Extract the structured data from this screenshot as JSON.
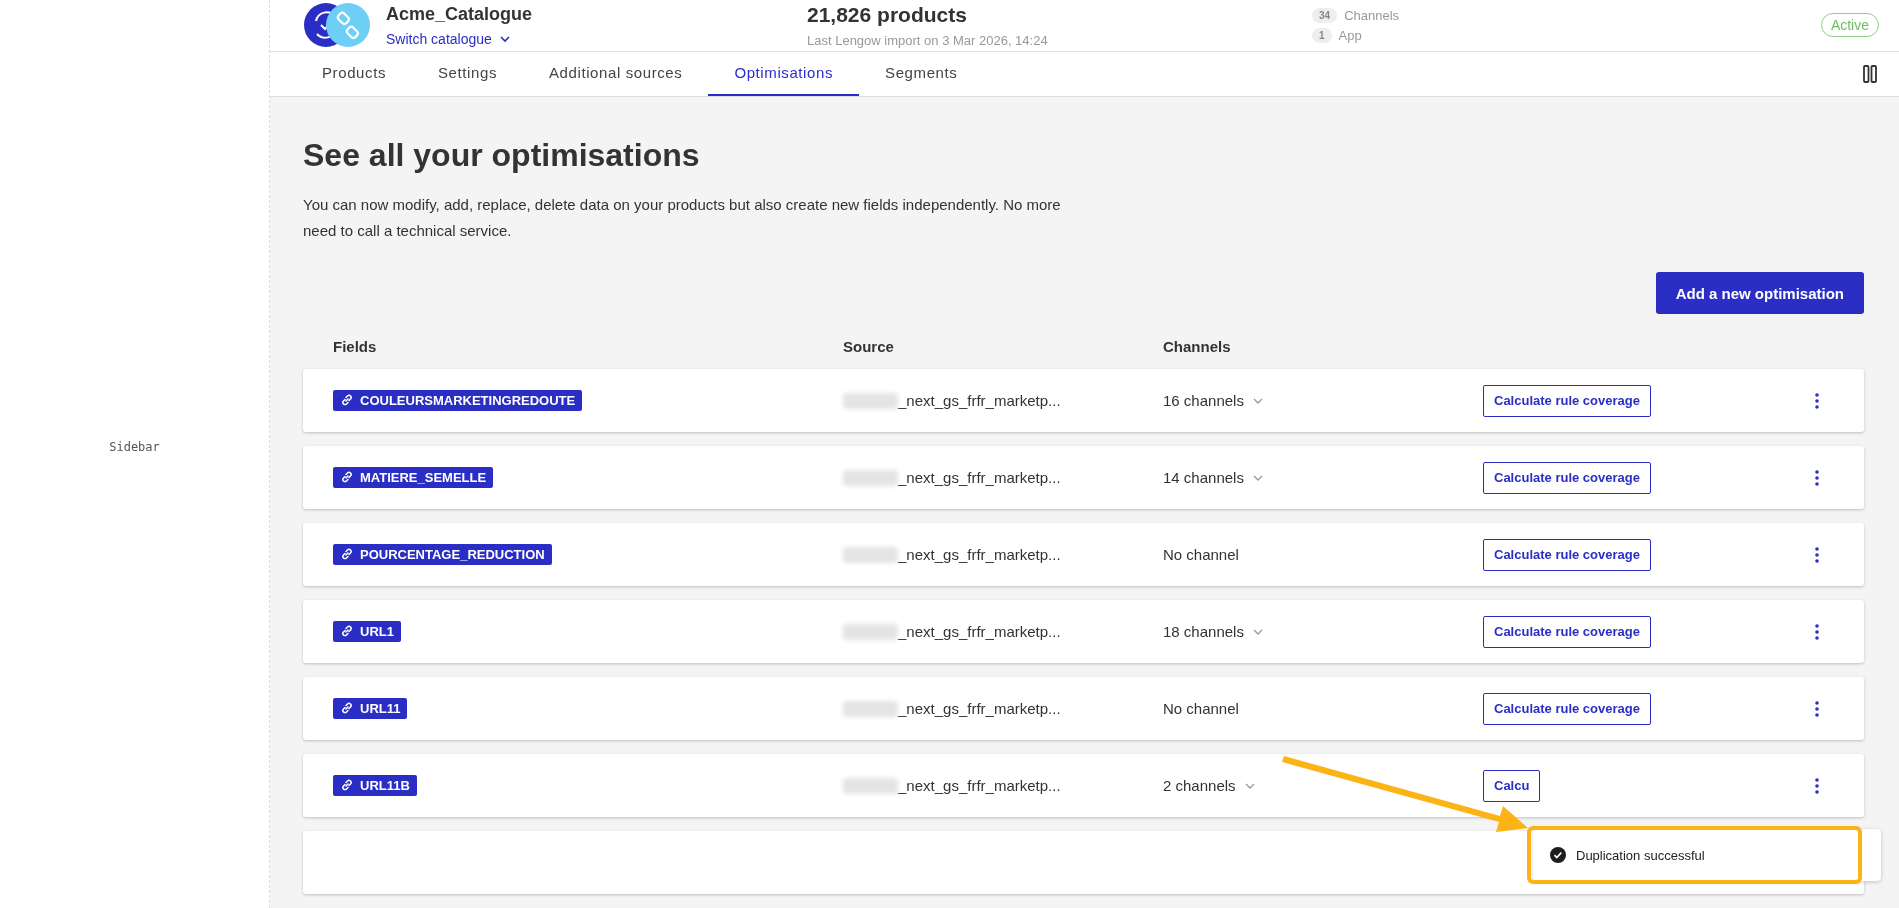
{
  "sidebar": {
    "label": "Sidebar"
  },
  "header": {
    "catalogue": "Acme_Catalogue",
    "switch_link": "Switch catalogue",
    "products": "21,826 products",
    "last_import": "Last Lengow import on 3 Mar 2026, 14:24",
    "counters": [
      {
        "count": "34",
        "label": "Channels"
      },
      {
        "count": "1",
        "label": "App"
      }
    ],
    "status": "Active"
  },
  "tabs": [
    {
      "label": "Products",
      "selected": false
    },
    {
      "label": "Settings",
      "selected": false
    },
    {
      "label": "Additional sources",
      "selected": false
    },
    {
      "label": "Optimisations",
      "selected": true
    },
    {
      "label": "Segments",
      "selected": false
    }
  ],
  "page": {
    "title": "See all your optimisations",
    "description": "You can now modify, add, replace, delete data on your products but also create new fields independently. No more need to call a technical service.",
    "add_button": "Add a new optimisation"
  },
  "table": {
    "columns": [
      "Fields",
      "Source",
      "Channels"
    ],
    "rows": [
      {
        "field": "COULEURSMARKETINGREDOUTE",
        "source": "_next_gs_frfr_marketp...",
        "channels": "16 channels",
        "expandable": true,
        "action": "Calculate rule coverage"
      },
      {
        "field": "MATIERE_SEMELLE",
        "source": "_next_gs_frfr_marketp...",
        "channels": "14 channels",
        "expandable": true,
        "action": "Calculate rule coverage"
      },
      {
        "field": "POURCENTAGE_REDUCTION",
        "source": "_next_gs_frfr_marketp...",
        "channels": "No channel",
        "expandable": false,
        "action": "Calculate rule coverage"
      },
      {
        "field": "URL1",
        "source": "_next_gs_frfr_marketp...",
        "channels": "18 channels",
        "expandable": true,
        "action": "Calculate rule coverage"
      },
      {
        "field": "URL11",
        "source": "_next_gs_frfr_marketp...",
        "channels": "No channel",
        "expandable": false,
        "action": "Calculate rule coverage"
      },
      {
        "field": "URL11B",
        "source": "_next_gs_frfr_marketp...",
        "channels": "2 channels",
        "expandable": true,
        "action": "Calcu"
      }
    ]
  },
  "toast": {
    "message": "Duplication successful"
  }
}
